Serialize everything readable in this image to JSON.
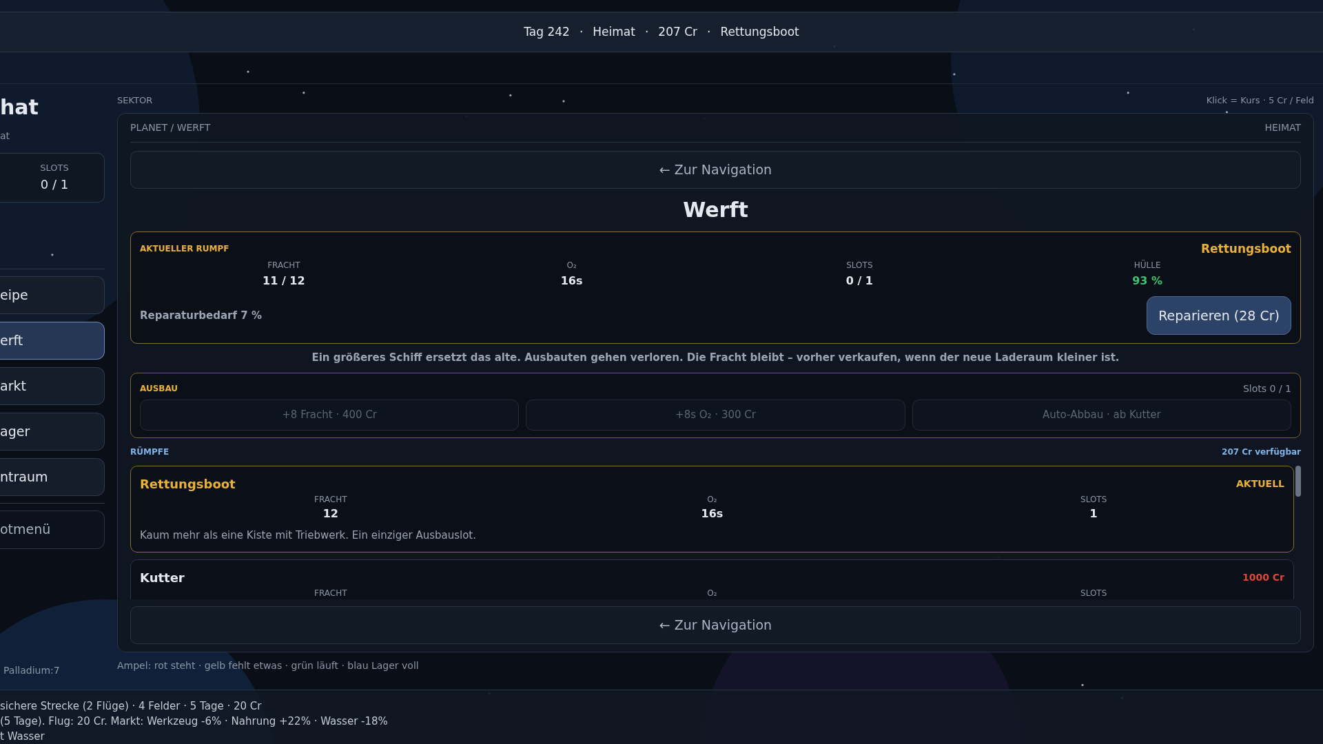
{
  "top_bar": [
    "Tag 242",
    "·",
    "Heimat",
    "·",
    "207 Cr",
    "·",
    "Rettungsboot"
  ],
  "sidebar": {
    "title": "hat",
    "subtitle": "at",
    "stats": [
      {
        "label": "SLOTS",
        "value": "0 / 1"
      }
    ],
    "nav": [
      {
        "label": "eipe",
        "selected": false
      },
      {
        "label": "erft",
        "selected": true
      },
      {
        "label": "arkt",
        "selected": false
      },
      {
        "label": "ager",
        "selected": false
      },
      {
        "label": "ntraum",
        "selected": false
      }
    ],
    "menu_button": "otmenü",
    "inventory": "Palladium:7"
  },
  "sector": {
    "label": "SEKTOR",
    "hint": "Klick = Kurs · 5 Cr / Feld"
  },
  "panel": {
    "title": "PLANET / WERFT",
    "location": "HEIMAT",
    "top_nav": "← Zur Navigation",
    "heading": "Werft",
    "current_hull": {
      "label": "AKTUELLER RUMPF",
      "name": "Rettungsboot",
      "stats": [
        {
          "label": "FRACHT",
          "value": "11 / 12",
          "kind": "plain"
        },
        {
          "label": "O₂",
          "value": "16s",
          "kind": "plain"
        },
        {
          "label": "SLOTS",
          "value": "0 / 1",
          "kind": "plain"
        },
        {
          "label": "HÜLLE",
          "value": "93 %",
          "kind": "good"
        }
      ],
      "repair_need": "Reparaturbedarf 7 %",
      "repair_button": "Reparieren (28 Cr)"
    },
    "note": "Ein größeres Schiff ersetzt das alte. Ausbauten gehen verloren. Die Fracht bleibt – vorher verkaufen, wenn der neue Laderaum kleiner ist.",
    "upgrades": {
      "label": "AUSBAU",
      "slots": "Slots 0 / 1",
      "items": [
        {
          "text": "+8 Fracht · 400 Cr",
          "disabled": true
        },
        {
          "text": "+8s O₂ · 300 Cr",
          "disabled": true
        },
        {
          "text": "Auto-Abbau · ab Kutter",
          "disabled": true
        }
      ]
    },
    "hulls": {
      "label": "RÜMPFE",
      "budget": "207 Cr verfügbar",
      "items": [
        {
          "name": "Rettungsboot",
          "current": true,
          "badge": "AKTUELL",
          "stats": [
            {
              "label": "FRACHT",
              "value": "12"
            },
            {
              "label": "O₂",
              "value": "16s"
            },
            {
              "label": "SLOTS",
              "value": "1"
            }
          ],
          "description": "Kaum mehr als eine Kiste mit Triebwerk. Ein einziger Ausbauslot."
        },
        {
          "name": "Kutter",
          "current": false,
          "badge": "1000 Cr",
          "stats": [
            {
              "label": "FRACHT"
            },
            {
              "label": "O₂"
            },
            {
              "label": "SLOTS"
            }
          ]
        }
      ]
    },
    "bottom_nav": "← Zur Navigation"
  },
  "legend": "Ampel: rot steht · gelb fehlt etwas · grün läuft · blau Lager voll",
  "log": [
    "sichere Strecke (2 Flüge) · 4 Felder · 5 Tage · 20 Cr",
    "(5 Tage). Flug: 20 Cr. Markt: Werkzeug -6% · Nahrung +22% · Wasser -18%",
    "t Wasser"
  ]
}
